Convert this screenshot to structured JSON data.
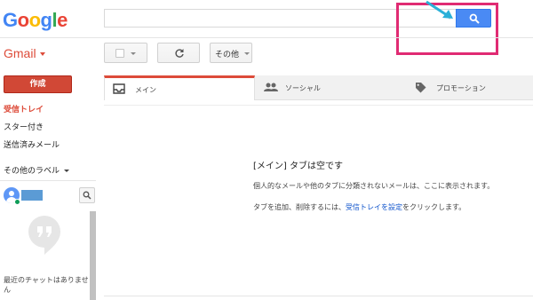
{
  "header": {
    "logo_letters": [
      {
        "ch": "G",
        "color": "#4285f4"
      },
      {
        "ch": "o",
        "color": "#ea4335"
      },
      {
        "ch": "o",
        "color": "#fbbc05"
      },
      {
        "ch": "g",
        "color": "#4285f4"
      },
      {
        "ch": "l",
        "color": "#34a853"
      },
      {
        "ch": "e",
        "color": "#ea4335"
      }
    ],
    "search_placeholder": "",
    "search_icon": "search-icon",
    "accent_color": "#4a8af4"
  },
  "app_switch": {
    "label": "Gmail"
  },
  "toolbar": {
    "select_icon": "checkbox-icon",
    "refresh_icon": "refresh-icon",
    "more_label": "その他"
  },
  "sidebar": {
    "compose_label": "作成",
    "items": [
      {
        "label": "受信トレイ"
      },
      {
        "label": "スター付き"
      },
      {
        "label": "送信済みメール"
      }
    ],
    "more_labels": "その他のラベル"
  },
  "chat": {
    "empty_text": "最近のチャットはありませ\nん"
  },
  "tabs": [
    {
      "label": "メイン",
      "icon": "inbox-icon"
    },
    {
      "label": "ソーシャル",
      "icon": "people-icon"
    },
    {
      "label": "プロモーション",
      "icon": "tag-icon"
    }
  ],
  "empty_state": {
    "title": "[メイン] タブは空です",
    "description": "個人的なメールや他のタブに分類されないメールは、ここに表示されます。",
    "hint_prefix": "タブを追加、削除するには、",
    "hint_link": "受信トレイを設定",
    "hint_suffix": "をクリックします。"
  },
  "colors": {
    "compose": "#d14836",
    "highlight": "#e02b73",
    "arrow": "#2ab0d8"
  }
}
